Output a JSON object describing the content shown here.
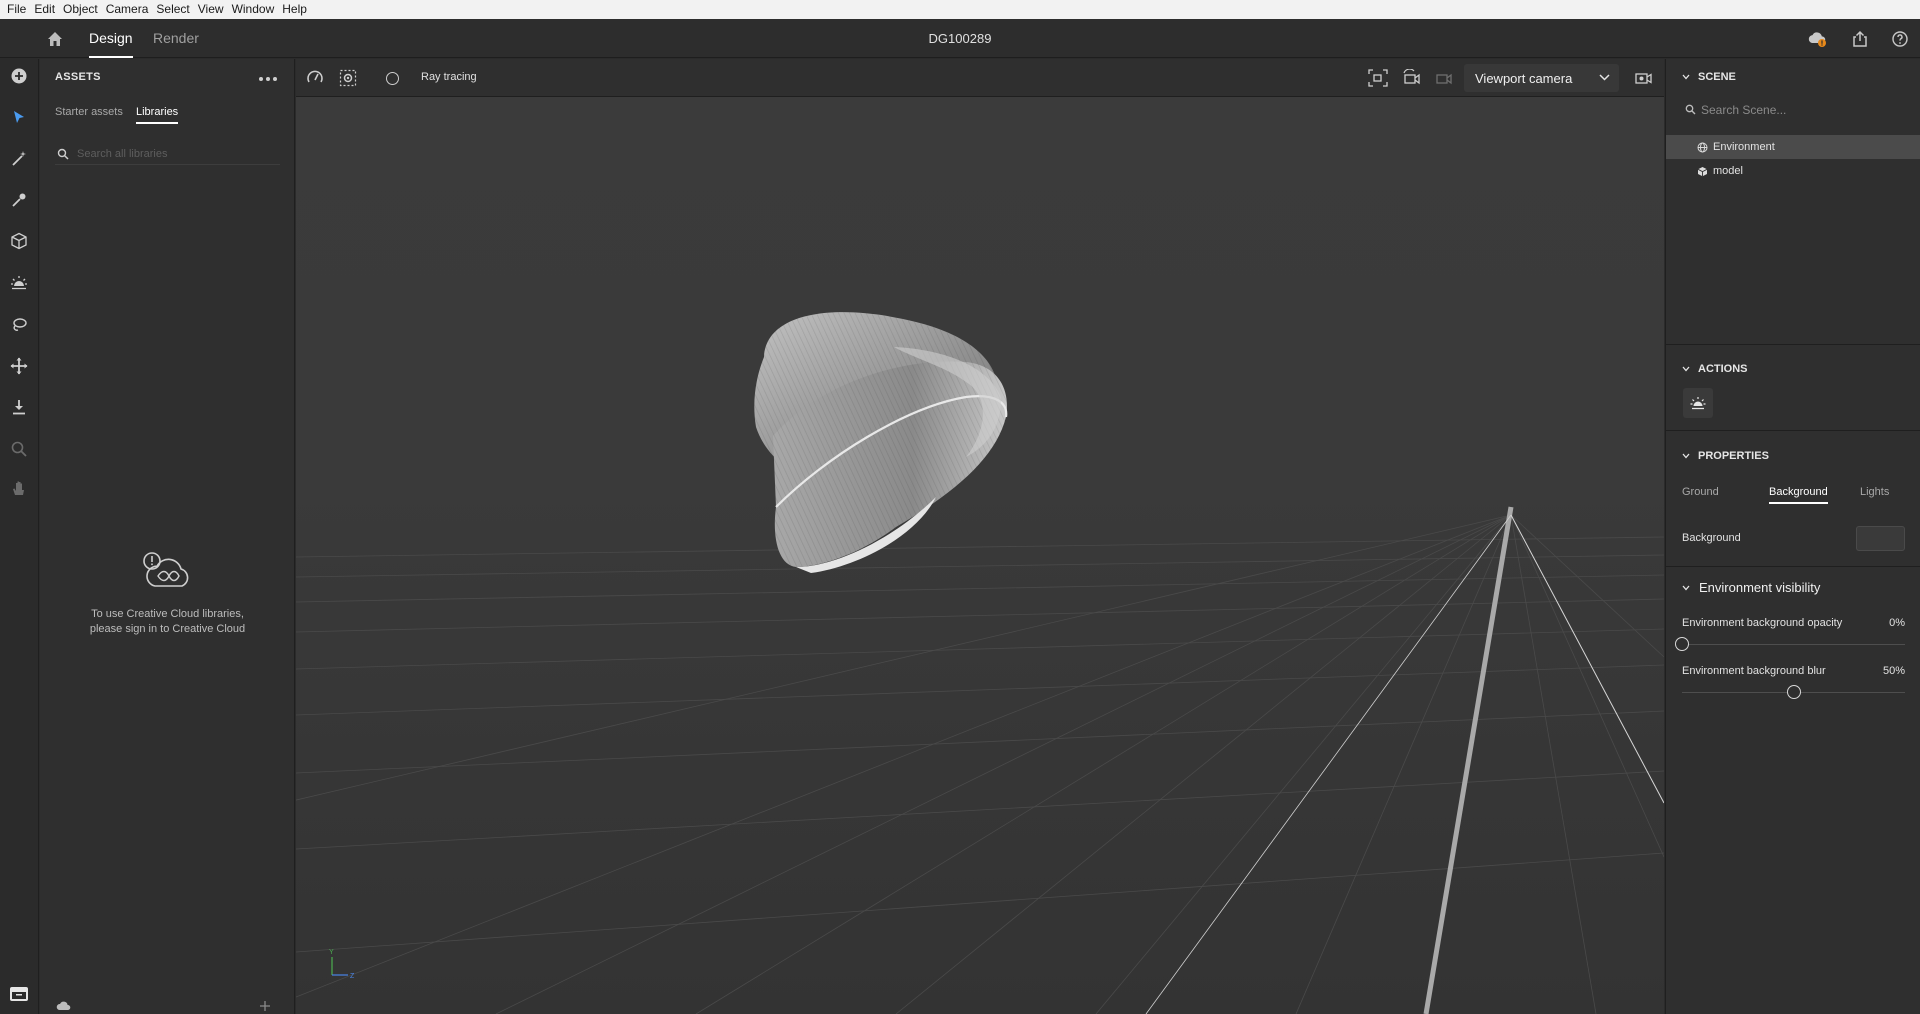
{
  "menu": [
    "File",
    "Edit",
    "Object",
    "Camera",
    "Select",
    "View",
    "Window",
    "Help"
  ],
  "header": {
    "title": "DG100289",
    "modes": {
      "design": "Design",
      "render": "Render"
    },
    "icons": [
      "home-icon",
      "cloud-sync-icon",
      "share-icon",
      "help-icon"
    ]
  },
  "tools": [
    "add-icon",
    "select-icon",
    "magic-wand-icon",
    "sampler-icon",
    "primitive-icon",
    "light-icon",
    "lasso-icon",
    "transform-icon",
    "drop-to-ground-icon",
    "zoom-icon",
    "hand-icon"
  ],
  "assets": {
    "title": "ASSETS",
    "tabs": {
      "starter": "Starter assets",
      "libraries": "Libraries"
    },
    "search_placeholder": "Search all libraries",
    "signin_line1": "To use Creative Cloud libraries,",
    "signin_line2": "please sign in to Creative Cloud"
  },
  "viewport": {
    "ray_tracing_label": "Ray tracing",
    "ray_tracing_on": false,
    "camera": "Viewport camera",
    "axis_y": "Y",
    "axis_z": "Z"
  },
  "scene": {
    "title": "SCENE",
    "search_placeholder": "Search Scene...",
    "items": [
      {
        "label": "Environment",
        "icon": "globe-icon",
        "selected": true
      },
      {
        "label": "model",
        "icon": "cube-icon",
        "selected": false
      }
    ]
  },
  "actions": {
    "title": "ACTIONS"
  },
  "properties": {
    "title": "PROPERTIES",
    "tabs": [
      "Ground",
      "Background",
      "Lights"
    ],
    "active_tab": "Background",
    "background_label": "Background",
    "env_visibility": "Environment visibility",
    "opacity_label": "Environment background opacity",
    "opacity_value": "0%",
    "opacity_fraction": 0,
    "blur_label": "Environment background blur",
    "blur_value": "50%",
    "blur_fraction": 0.5
  },
  "colors": {
    "panel": "#2f2f2f",
    "viewport": "#3a3a3a",
    "selected": "#4b4b4b",
    "menubar": "#f2f2f2",
    "cloud_badge": "#e8891a"
  }
}
